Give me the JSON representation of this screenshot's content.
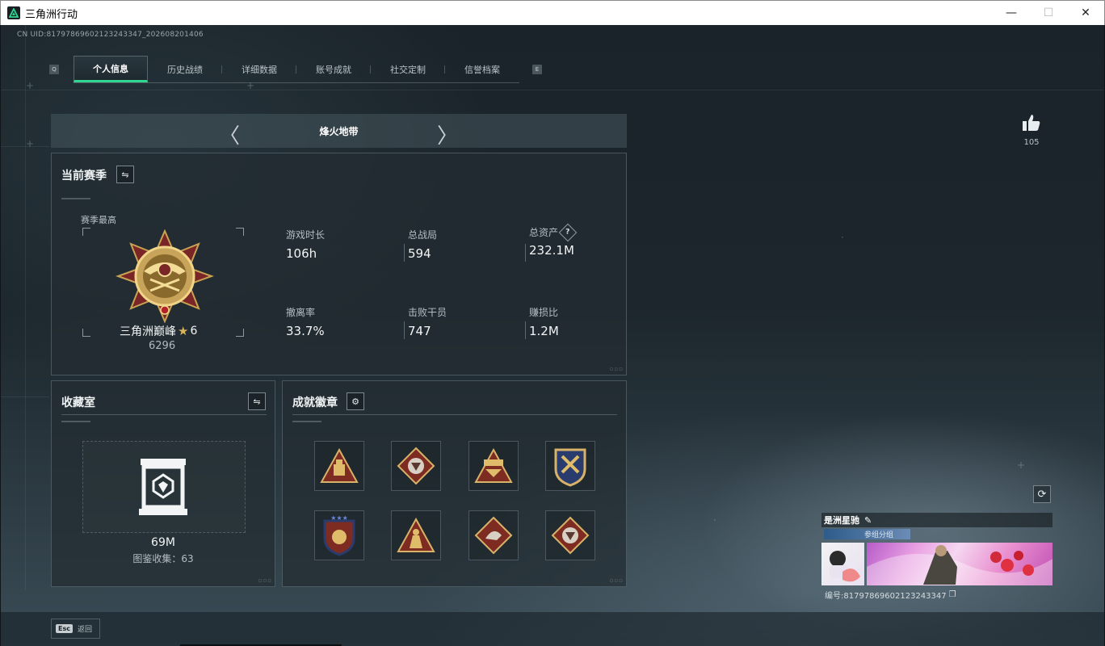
{
  "window": {
    "title": "三角洲行动",
    "minimize_glyph": "—",
    "maximize_glyph": "☐",
    "close_glyph": "✕"
  },
  "uid_text": "CN UID:8179786960212324334​7_202608201406",
  "nav": {
    "left_key": "Q",
    "right_key": "E",
    "tabs": [
      {
        "label": "个人信息",
        "active": true
      },
      {
        "label": "历史战绩",
        "active": false
      },
      {
        "label": "详细数据",
        "active": false
      },
      {
        "label": "账号成就",
        "active": false
      },
      {
        "label": "社交定制",
        "active": false
      },
      {
        "label": "信誉档案",
        "active": false
      }
    ]
  },
  "mode": {
    "title": "烽火地带",
    "prev_glyph": "〈",
    "next_glyph": "〉"
  },
  "season": {
    "title": "当前赛季",
    "best_label": "赛季最高",
    "rank_name": "三角洲巅峰",
    "rank_star": "★",
    "rank_level": "6",
    "rank_score": "6296",
    "stats": [
      {
        "label": "游戏时长",
        "value": "106h"
      },
      {
        "label": "总战局",
        "value": "594"
      },
      {
        "label": "总资产",
        "value": "232.1M",
        "help": "?"
      },
      {
        "label": "撤离率",
        "value": "33.7%"
      },
      {
        "label": "击败干员",
        "value": "747"
      },
      {
        "label": "赚损比",
        "value": "1.2M"
      }
    ]
  },
  "collection": {
    "title": "收藏室",
    "value": "69M",
    "count_text": "图鉴收集：63"
  },
  "achievements": {
    "title": "成就徽章",
    "badges": [
      "badge-1",
      "badge-2",
      "badge-3",
      "badge-4",
      "badge-5",
      "badge-6",
      "badge-7",
      "badge-8"
    ]
  },
  "likes": {
    "count": "105"
  },
  "card": {
    "name": "是洲星驰",
    "group": "参组分组",
    "id_text": "编号:8179786960212324334​7"
  },
  "bottom": {
    "esc_key": "Esc",
    "back_label": "返回"
  },
  "colors": {
    "accent_green": "#2fd68f",
    "rank_gold": "#d9b45a",
    "panel_bg": "#222c32"
  },
  "icons": [
    "app-logo-icon",
    "chevron-left-icon",
    "chevron-right-icon",
    "swap-icon",
    "gear-icon",
    "help-icon",
    "thumbs-up-icon",
    "refresh-icon",
    "edit-pencil-icon",
    "copy-icon",
    "rank-emblem-icon",
    "display-case-icon"
  ]
}
